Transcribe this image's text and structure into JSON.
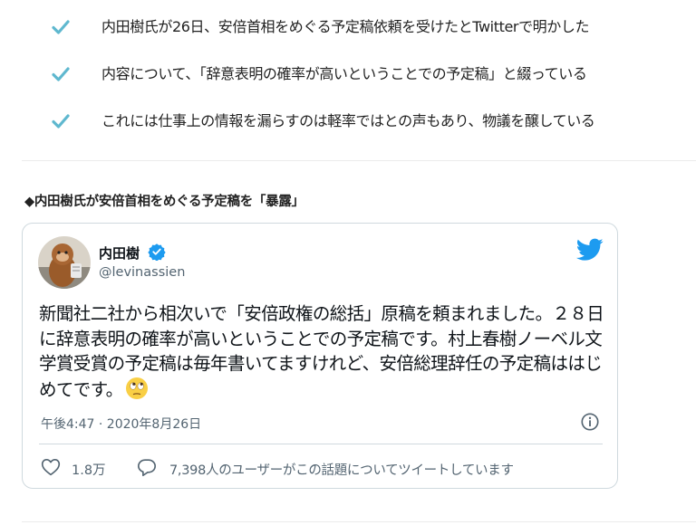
{
  "summary": {
    "items": [
      {
        "text": "内田樹氏が26日、安倍首相をめぐる予定稿依頼を受けたとTwitterで明かした"
      },
      {
        "text": "内容について、「辞意表明の確率が高いということでの予定稿」と綴っている"
      },
      {
        "text": "これには仕事上の情報を漏らすのは軽率ではとの声もあり、物議を醸している"
      }
    ],
    "check_icon": "check-icon",
    "check_color": "#5fb8cf"
  },
  "section": {
    "heading": "◆内田樹氏が安倍首相をめぐる予定稿を「暴露」"
  },
  "tweet": {
    "author_name": "内田樹",
    "handle": "@levinassien",
    "verified": true,
    "verified_color": "#1d9bf0",
    "brand_icon": "twitter-bird-icon",
    "brand_color": "#1d9bf0",
    "body": "新聞社二社から相次いで「安倍政権の総括」原稿を頼まれました。２８日に辞意表明の確率が高いということでの予定稿です。村上春樹ノーベル文学賞受賞の予定稿は毎年書いてますけれど、安倍総理辞任の予定稿ははじめてです。",
    "emoji": "rolling-eyes-emoji",
    "timestamp": "午後4:47 · 2020年8月26日",
    "likes": "1.8万",
    "replies": "7,398人のユーザーがこの話題についてツイートしています"
  }
}
